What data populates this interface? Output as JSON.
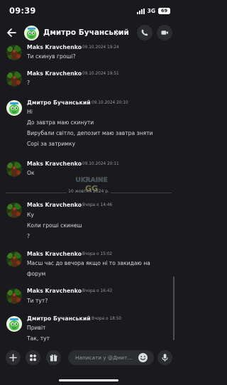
{
  "status_bar": {
    "time": "09:39",
    "network": "3G",
    "battery": "69"
  },
  "header": {
    "title": "Дмитро Бучанський"
  },
  "watermark_text": "UKRAINE GG",
  "divider": {
    "label": "10 жовтня 2024 р."
  },
  "messages": [
    {
      "author": "Maks Kravchenko",
      "time": "09.10.2024 19:24",
      "lines": [
        "Ти скинув гроші?"
      ]
    },
    {
      "author": "Maks Kravchenko",
      "time": "09.10.2024 19:51",
      "lines": [
        "?"
      ]
    },
    {
      "author": "Дмитро Бучанський",
      "time": "09.10.2024 20:10",
      "lines": [
        "Ні",
        "До завтра маю скинути",
        "Вирубали світло, депозит маю завтра зняти",
        "Сорі за затримку"
      ]
    },
    {
      "author": "Maks Kravchenko",
      "time": "09.10.2024 20:11",
      "lines": [
        "Ок"
      ]
    },
    {
      "author": "Maks Kravchenko",
      "time": "Вчора о 14:46",
      "lines": [
        "Ку",
        "Коли гроші скинеш",
        "?"
      ]
    },
    {
      "author": "Maks Kravchenko",
      "time": "Вчора о 15:02",
      "lines": [
        "Масш час до вечора якщо ні то закидаю на",
        "форум"
      ]
    },
    {
      "author": "Maks Kravchenko",
      "time": "Вчора о 16:43",
      "lines": [
        "Ти тут?"
      ]
    },
    {
      "author": "Дмитро Бучанський",
      "time": "Вчора о 18:50",
      "lines": [
        "Привіт",
        "Так, тут"
      ]
    }
  ],
  "composer": {
    "placeholder": "Написати у @Дмит..."
  },
  "colors": {
    "background": "#1a1a1e",
    "surface": "#2b2d31",
    "muted": "#949ba4",
    "text": "#dbdee1"
  },
  "icons": [
    "back-arrow-icon",
    "chevron-right-icon",
    "phone-icon",
    "video-icon",
    "plus-icon",
    "apps-icon",
    "gift-icon",
    "emoji-icon",
    "microphone-icon"
  ]
}
